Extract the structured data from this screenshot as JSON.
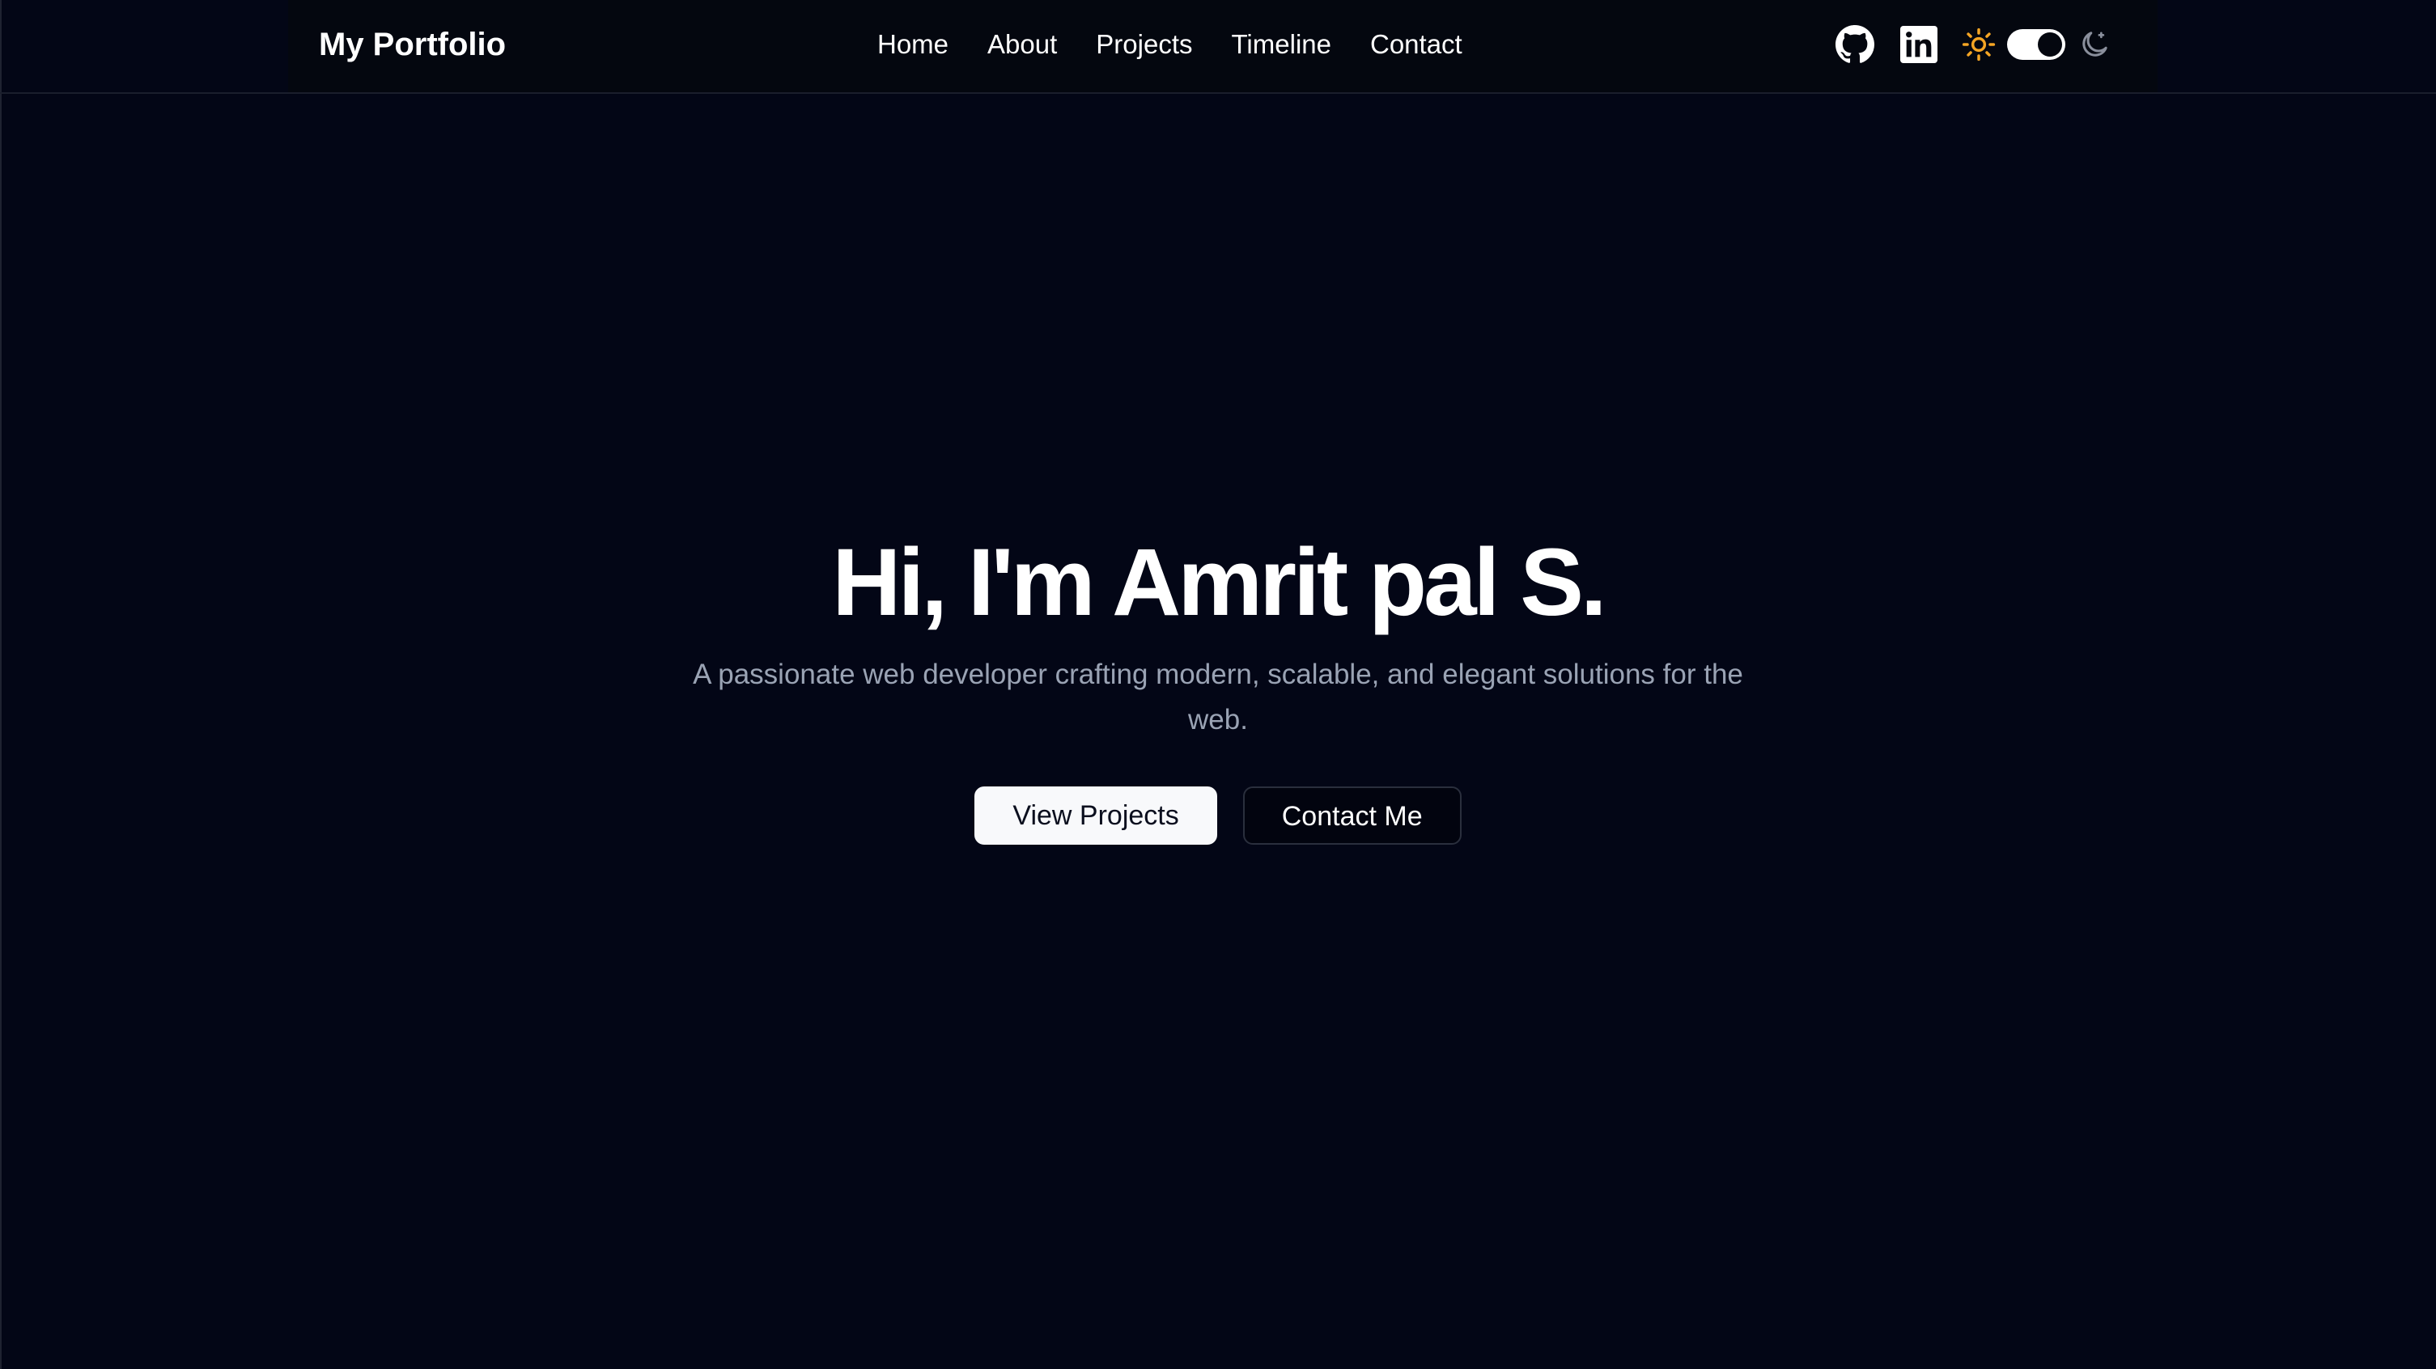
{
  "navbar": {
    "brand": "My Portfolio",
    "links": [
      "Home",
      "About",
      "Projects",
      "Timeline",
      "Contact"
    ],
    "icons": {
      "github": "github-icon",
      "linkedin": "linkedin-icon",
      "sun": "sun-icon",
      "moon": "moon-icon"
    },
    "theme_toggle_state": "dark"
  },
  "hero": {
    "title": "Hi, I'm Amrit pal S.",
    "subtitle": "A passionate web developer crafting modern, scalable, and elegant solutions for the web.",
    "primary_button": "View Projects",
    "secondary_button": "Contact Me"
  },
  "colors": {
    "background": "#030616",
    "text": "#ffffff",
    "muted_text": "#9aa3b4",
    "sun_accent": "#f5a524"
  }
}
